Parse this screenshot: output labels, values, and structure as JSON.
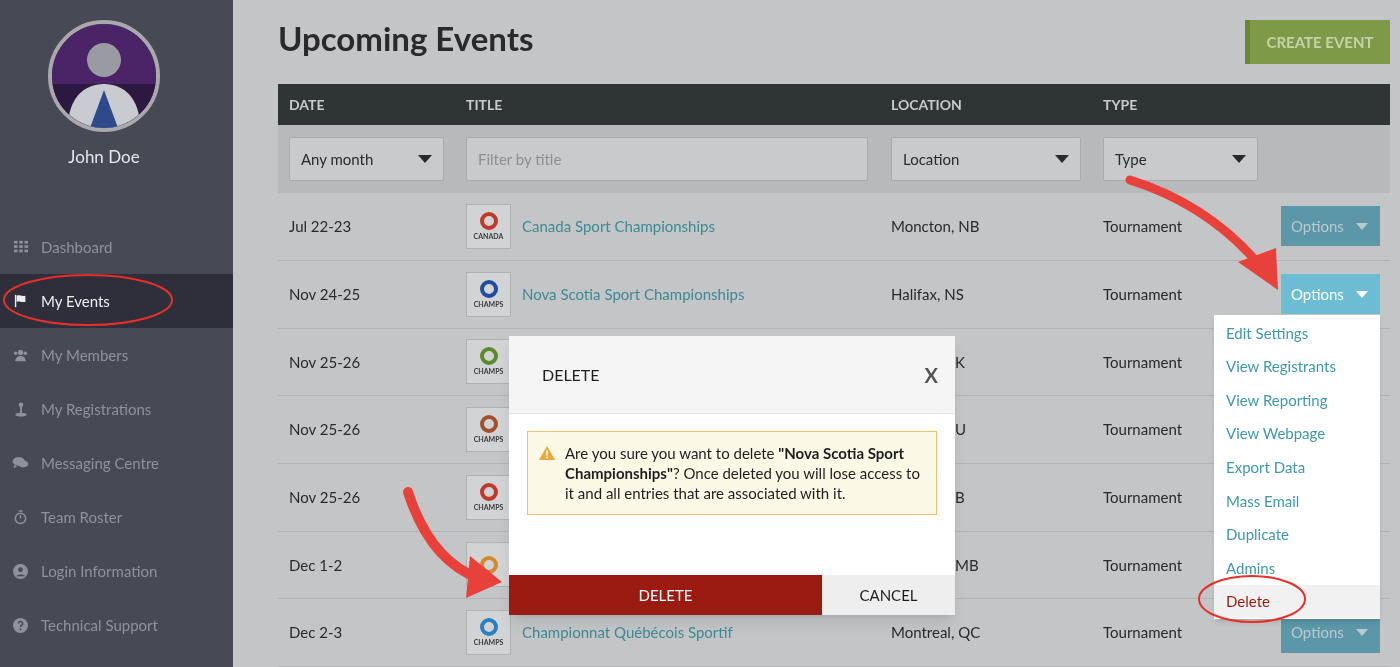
{
  "sidebar": {
    "user_name": "John Doe",
    "items": [
      {
        "label": "Dashboard",
        "selected": false
      },
      {
        "label": "My Events",
        "selected": true
      },
      {
        "label": "My Members",
        "selected": false
      },
      {
        "label": "My Registrations",
        "selected": false
      },
      {
        "label": "Messaging Centre",
        "selected": false
      },
      {
        "label": "Team Roster",
        "selected": false
      },
      {
        "label": "Login Information",
        "selected": false
      },
      {
        "label": "Technical Support",
        "selected": false
      }
    ]
  },
  "page_title": "Upcoming Events",
  "create_button": "CREATE EVENT",
  "table": {
    "columns": [
      "DATE",
      "TITLE",
      "LOCATION",
      "TYPE"
    ],
    "filters": {
      "month": "Any month",
      "title_placeholder": "Filter by title",
      "location": "Location",
      "type": "Type"
    },
    "rows": [
      {
        "date": "Jul 22-23",
        "logo": {
          "text": "CANADA",
          "color": "#c0392b"
        },
        "title": "Canada Sport Championships",
        "location": "Moncton, NB",
        "type": "Tournament",
        "options": {
          "label": "Options",
          "active": false
        }
      },
      {
        "date": "Nov 24-25",
        "logo": {
          "text": "CHAMPS",
          "color": "#1f4e9c"
        },
        "title": "Nova Scotia Sport Championships",
        "location": "Halifax, NS",
        "type": "Tournament",
        "options": {
          "label": "Options",
          "active": true
        }
      },
      {
        "date": "Nov 25-26",
        "logo": {
          "text": "CHAMPS",
          "color": "#5a8a2a"
        },
        "location": "K",
        "type": "Tournament"
      },
      {
        "date": "Nov 25-26",
        "logo": {
          "text": "CHAMPS",
          "color": "#a0522d"
        },
        "location": "U",
        "type": "Tournament"
      },
      {
        "date": "Nov 25-26",
        "logo": {
          "text": "CHAMPS",
          "color": "#c0392b"
        },
        "location": "B",
        "type": "Tournament"
      },
      {
        "date": "Dec 1-2",
        "logo": {
          "color": "#d08a2a"
        },
        "location": "MB",
        "type": "Tournament"
      },
      {
        "date": "Dec 2-3",
        "logo": {
          "text": "CHAMPS",
          "color": "#2a7fc0"
        },
        "title": "Championnat Québécois Sportif",
        "location": "Montreal, QC",
        "type": "Tournament",
        "options": {
          "label": "Options",
          "active": false
        }
      }
    ]
  },
  "options_menu": [
    {
      "label": "Edit Settings",
      "kind": "link",
      "selected": false
    },
    {
      "label": "View Registrants",
      "kind": "link",
      "selected": false
    },
    {
      "label": "View Reporting",
      "kind": "link",
      "selected": false
    },
    {
      "label": "View Webpage",
      "kind": "link",
      "selected": false
    },
    {
      "label": "Export Data",
      "kind": "link",
      "selected": false
    },
    {
      "label": "Mass Email",
      "kind": "link",
      "selected": false
    },
    {
      "label": "Duplicate",
      "kind": "link",
      "selected": false
    },
    {
      "label": "Admins",
      "kind": "link",
      "selected": false
    },
    {
      "label": "Delete",
      "kind": "danger",
      "selected": true
    }
  ],
  "dialog": {
    "title": "DELETE",
    "close": "X",
    "message": "Are you sure you want to delete **\"Nova Scotia Sport Championships\"**? Once deleted you will lose access to it and all entries that are associated with it.",
    "confirm": "DELETE",
    "cancel": "CANCEL"
  }
}
